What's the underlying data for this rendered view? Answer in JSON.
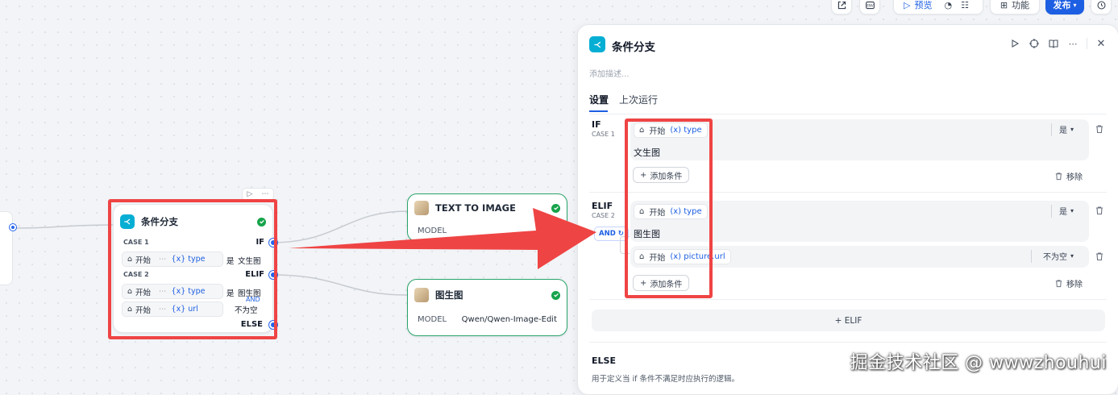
{
  "toolbar": {
    "preview_label": "预览",
    "features_label": "功能",
    "publish_label": "发布"
  },
  "canvas": {
    "condition_node": {
      "title": "条件分支",
      "case1_label": "CASE 1",
      "case1_tag": "IF",
      "case1_chip_source": "开始",
      "case1_chip_var": "{x} type",
      "case1_operator": "是",
      "case1_value": "文生图",
      "case2_label": "CASE 2",
      "case2_tag": "ELIF",
      "case2_chip1_source": "开始",
      "case2_chip1_var": "{x} type",
      "case2_operator1": "是",
      "case2_value1": "图生图",
      "case2_logic": "AND",
      "case2_chip2_source": "开始",
      "case2_chip2_var": "{x} url",
      "case2_operator2": "不为空",
      "else_tag": "ELSE"
    },
    "text_to_image_node": {
      "title": "TEXT TO IMAGE",
      "model_label": "MODEL"
    },
    "image_to_image_node": {
      "title": "图生图",
      "model_label": "MODEL",
      "model_value": "Qwen/Qwen-Image-Edit"
    }
  },
  "panel": {
    "title": "条件分支",
    "description_placeholder": "添加描述...",
    "tabs": [
      "设置",
      "上次运行"
    ],
    "if_block": {
      "title": "IF",
      "case": "CASE 1",
      "chip_source": "开始",
      "chip_var": "(x) type",
      "operator": "是",
      "value": "文生图",
      "add_condition": "添加条件",
      "remove": "移除"
    },
    "elif_block": {
      "title": "ELIF",
      "case": "CASE 2",
      "logic": "AND",
      "cond1_source": "开始",
      "cond1_var": "(x) type",
      "cond1_operator": "是",
      "cond1_value": "图生图",
      "cond2_source": "开始",
      "cond2_var": "(x) picture.url",
      "cond2_operator": "不为空",
      "add_condition": "添加条件",
      "remove": "移除"
    },
    "add_elif": "+ ELIF",
    "else_block": {
      "title": "ELSE",
      "description": "用于定义当 if 条件不满足时应执行的逻辑。"
    }
  },
  "watermark": "掘金技术社区 @ wwwzhouhui",
  "colors": {
    "accent": "#1d5fe3",
    "highlight": "#ef4444",
    "success": "#16a34a",
    "node_icon": "#06aed4"
  }
}
